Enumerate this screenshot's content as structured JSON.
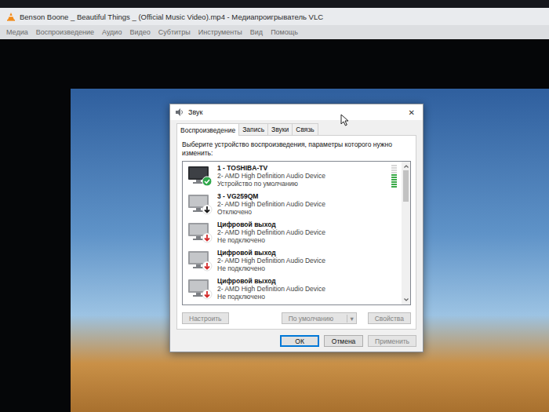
{
  "player": {
    "title": "Benson Boone _ Beautiful Things _ (Official Music Video).mp4 - Медиапроигрыватель VLC",
    "menu": [
      "Медиа",
      "Воспроизведение",
      "Аудио",
      "Видео",
      "Субтитры",
      "Инструменты",
      "Вид",
      "Помощь"
    ]
  },
  "dialog": {
    "title": "Звук",
    "close": "✕",
    "tabs": [
      {
        "label": "Воспроизведение",
        "selected": true
      },
      {
        "label": "Запись",
        "selected": false
      },
      {
        "label": "Звуки",
        "selected": false
      },
      {
        "label": "Связь",
        "selected": false
      }
    ],
    "instruction": "Выберите устройство воспроизведения, параметры которого нужно изменить:",
    "devices": [
      {
        "name": "1 - TOSHIBA-TV",
        "driver": "2- AMD High Definition Audio Device",
        "status": "Устройство по умолчанию",
        "kind": "default",
        "selected": false,
        "level": 0.6
      },
      {
        "name": "3 - VG259QM",
        "driver": "2- AMD High Definition Audio Device",
        "status": "Отключено",
        "kind": "disabled",
        "selected": false,
        "level": 0
      },
      {
        "name": "Цифровой выход",
        "driver": "2- AMD High Definition Audio Device",
        "status": "Не подключено",
        "kind": "unplugged",
        "selected": false,
        "level": 0
      },
      {
        "name": "Цифровой выход",
        "driver": "2- AMD High Definition Audio Device",
        "status": "Не подключено",
        "kind": "unplugged",
        "selected": false,
        "level": 0
      },
      {
        "name": "Цифровой выход",
        "driver": "2- AMD High Definition Audio Device",
        "status": "Не подключено",
        "kind": "unplugged",
        "selected": false,
        "level": 0
      }
    ],
    "device_buttons": [
      {
        "label": "Настроить",
        "disabled": true,
        "dropdown": ""
      },
      {
        "label": "По умолчанию",
        "disabled": true,
        "dropdown": "▾"
      },
      {
        "label": "Свойства",
        "disabled": true,
        "dropdown": ""
      }
    ],
    "buttons": [
      {
        "label": "ОК",
        "disabled": false,
        "focused": true
      },
      {
        "label": "Отмена",
        "disabled": false,
        "focused": false
      },
      {
        "label": "Применить",
        "disabled": true,
        "focused": false
      }
    ]
  }
}
